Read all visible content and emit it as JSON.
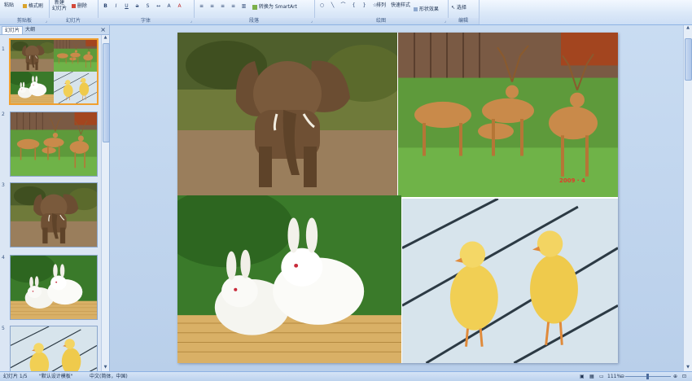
{
  "ribbon": {
    "clipboard": {
      "paste": "粘贴",
      "format_painter": "格式刷",
      "group_label": "剪贴板"
    },
    "slides": {
      "new_slide_line1": "新建",
      "new_slide_line2": "幻灯片",
      "delete": "删除",
      "group_label": "幻灯片"
    },
    "font": {
      "group_label": "字体"
    },
    "paragraph": {
      "smartart": "转换为 SmartArt",
      "group_label": "段落"
    },
    "drawing": {
      "arrange": "排列",
      "quick_styles": "快速样式",
      "shape_effects": "形状效果",
      "group_label": "绘图"
    },
    "editing": {
      "select": "选择",
      "group_label": "编辑"
    }
  },
  "panel": {
    "tab_slides": "幻灯片",
    "tab_outline": "大纲",
    "close": "×",
    "slide_numbers": [
      "1",
      "2",
      "3",
      "4",
      "5"
    ]
  },
  "slide": {
    "deer_caption": "2009 · 4"
  },
  "status": {
    "slide_position": "幻灯片 1/5",
    "theme": "\"默认设计模板\"",
    "language": "中文(简体，中国)",
    "zoom": "111%"
  },
  "colors": {
    "accent_selected": "#f0a030",
    "ribbon_border": "#8db2e3"
  }
}
